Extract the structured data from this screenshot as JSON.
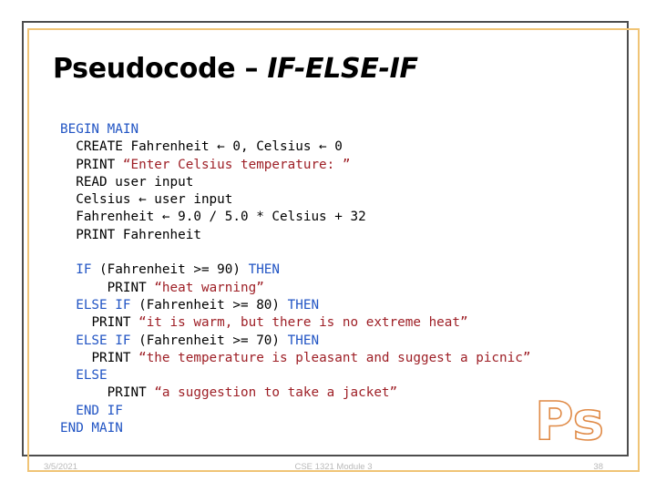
{
  "slide": {
    "title_plain": "Pseudocode – ",
    "title_italic": "IF-ELSE-IF",
    "accent_tan": "#f0c476",
    "accent_dark": "#4d4d4d",
    "keyword_color": "#2255c4",
    "string_color": "#9e1f26",
    "plain_color": "#000000"
  },
  "code": {
    "lines": [
      {
        "indent": 0,
        "parts": [
          {
            "t": "BEGIN MAIN",
            "c": "kw"
          }
        ]
      },
      {
        "indent": 1,
        "parts": [
          {
            "t": "CREATE Fahrenheit ← 0, Celsius ← 0",
            "c": "pln"
          }
        ]
      },
      {
        "indent": 1,
        "parts": [
          {
            "t": "PRINT ",
            "c": "pln"
          },
          {
            "t": "“Enter Celsius temperature: ”",
            "c": "str"
          }
        ]
      },
      {
        "indent": 1,
        "parts": [
          {
            "t": "READ user input",
            "c": "pln"
          }
        ]
      },
      {
        "indent": 1,
        "parts": [
          {
            "t": "Celsius ← user input",
            "c": "pln"
          }
        ]
      },
      {
        "indent": 1,
        "parts": [
          {
            "t": "Fahrenheit ← 9.0 / 5.0 * Celsius + 32",
            "c": "pln"
          }
        ]
      },
      {
        "indent": 1,
        "parts": [
          {
            "t": "PRINT Fahrenheit",
            "c": "pln"
          }
        ]
      },
      {
        "indent": 0,
        "parts": []
      },
      {
        "indent": 1,
        "parts": [
          {
            "t": "IF",
            "c": "kw"
          },
          {
            "t": " (Fahrenheit >= 90) ",
            "c": "pln"
          },
          {
            "t": "THEN",
            "c": "kw"
          }
        ]
      },
      {
        "indent": 3,
        "parts": [
          {
            "t": "PRINT ",
            "c": "pln"
          },
          {
            "t": "“heat warning”",
            "c": "str"
          }
        ]
      },
      {
        "indent": 1,
        "parts": [
          {
            "t": "ELSE IF",
            "c": "kw"
          },
          {
            "t": " (Fahrenheit >= 80) ",
            "c": "pln"
          },
          {
            "t": "THEN",
            "c": "kw"
          }
        ]
      },
      {
        "indent": 2,
        "parts": [
          {
            "t": "PRINT ",
            "c": "pln"
          },
          {
            "t": "“it is warm, but there is no extreme heat”",
            "c": "str"
          }
        ]
      },
      {
        "indent": 1,
        "parts": [
          {
            "t": "ELSE IF",
            "c": "kw"
          },
          {
            "t": " (Fahrenheit >= 70) ",
            "c": "pln"
          },
          {
            "t": "THEN",
            "c": "kw"
          }
        ]
      },
      {
        "indent": 2,
        "parts": [
          {
            "t": "PRINT ",
            "c": "pln"
          },
          {
            "t": "“the temperature is pleasant and suggest a picnic”",
            "c": "str"
          }
        ]
      },
      {
        "indent": 1,
        "parts": [
          {
            "t": "ELSE",
            "c": "kw"
          }
        ]
      },
      {
        "indent": 3,
        "parts": [
          {
            "t": "PRINT ",
            "c": "pln"
          },
          {
            "t": "“a suggestion to take a jacket”",
            "c": "str"
          }
        ]
      },
      {
        "indent": 1,
        "parts": [
          {
            "t": "END IF",
            "c": "kw"
          }
        ]
      },
      {
        "indent": 0,
        "parts": [
          {
            "t": "END MAIN",
            "c": "kw"
          }
        ]
      }
    ]
  },
  "logo": {
    "text": "Ps",
    "color": "#e08a46"
  },
  "footer": {
    "date": "3/5/2021",
    "course": "CSE 1321 Module 3",
    "page": "38"
  }
}
